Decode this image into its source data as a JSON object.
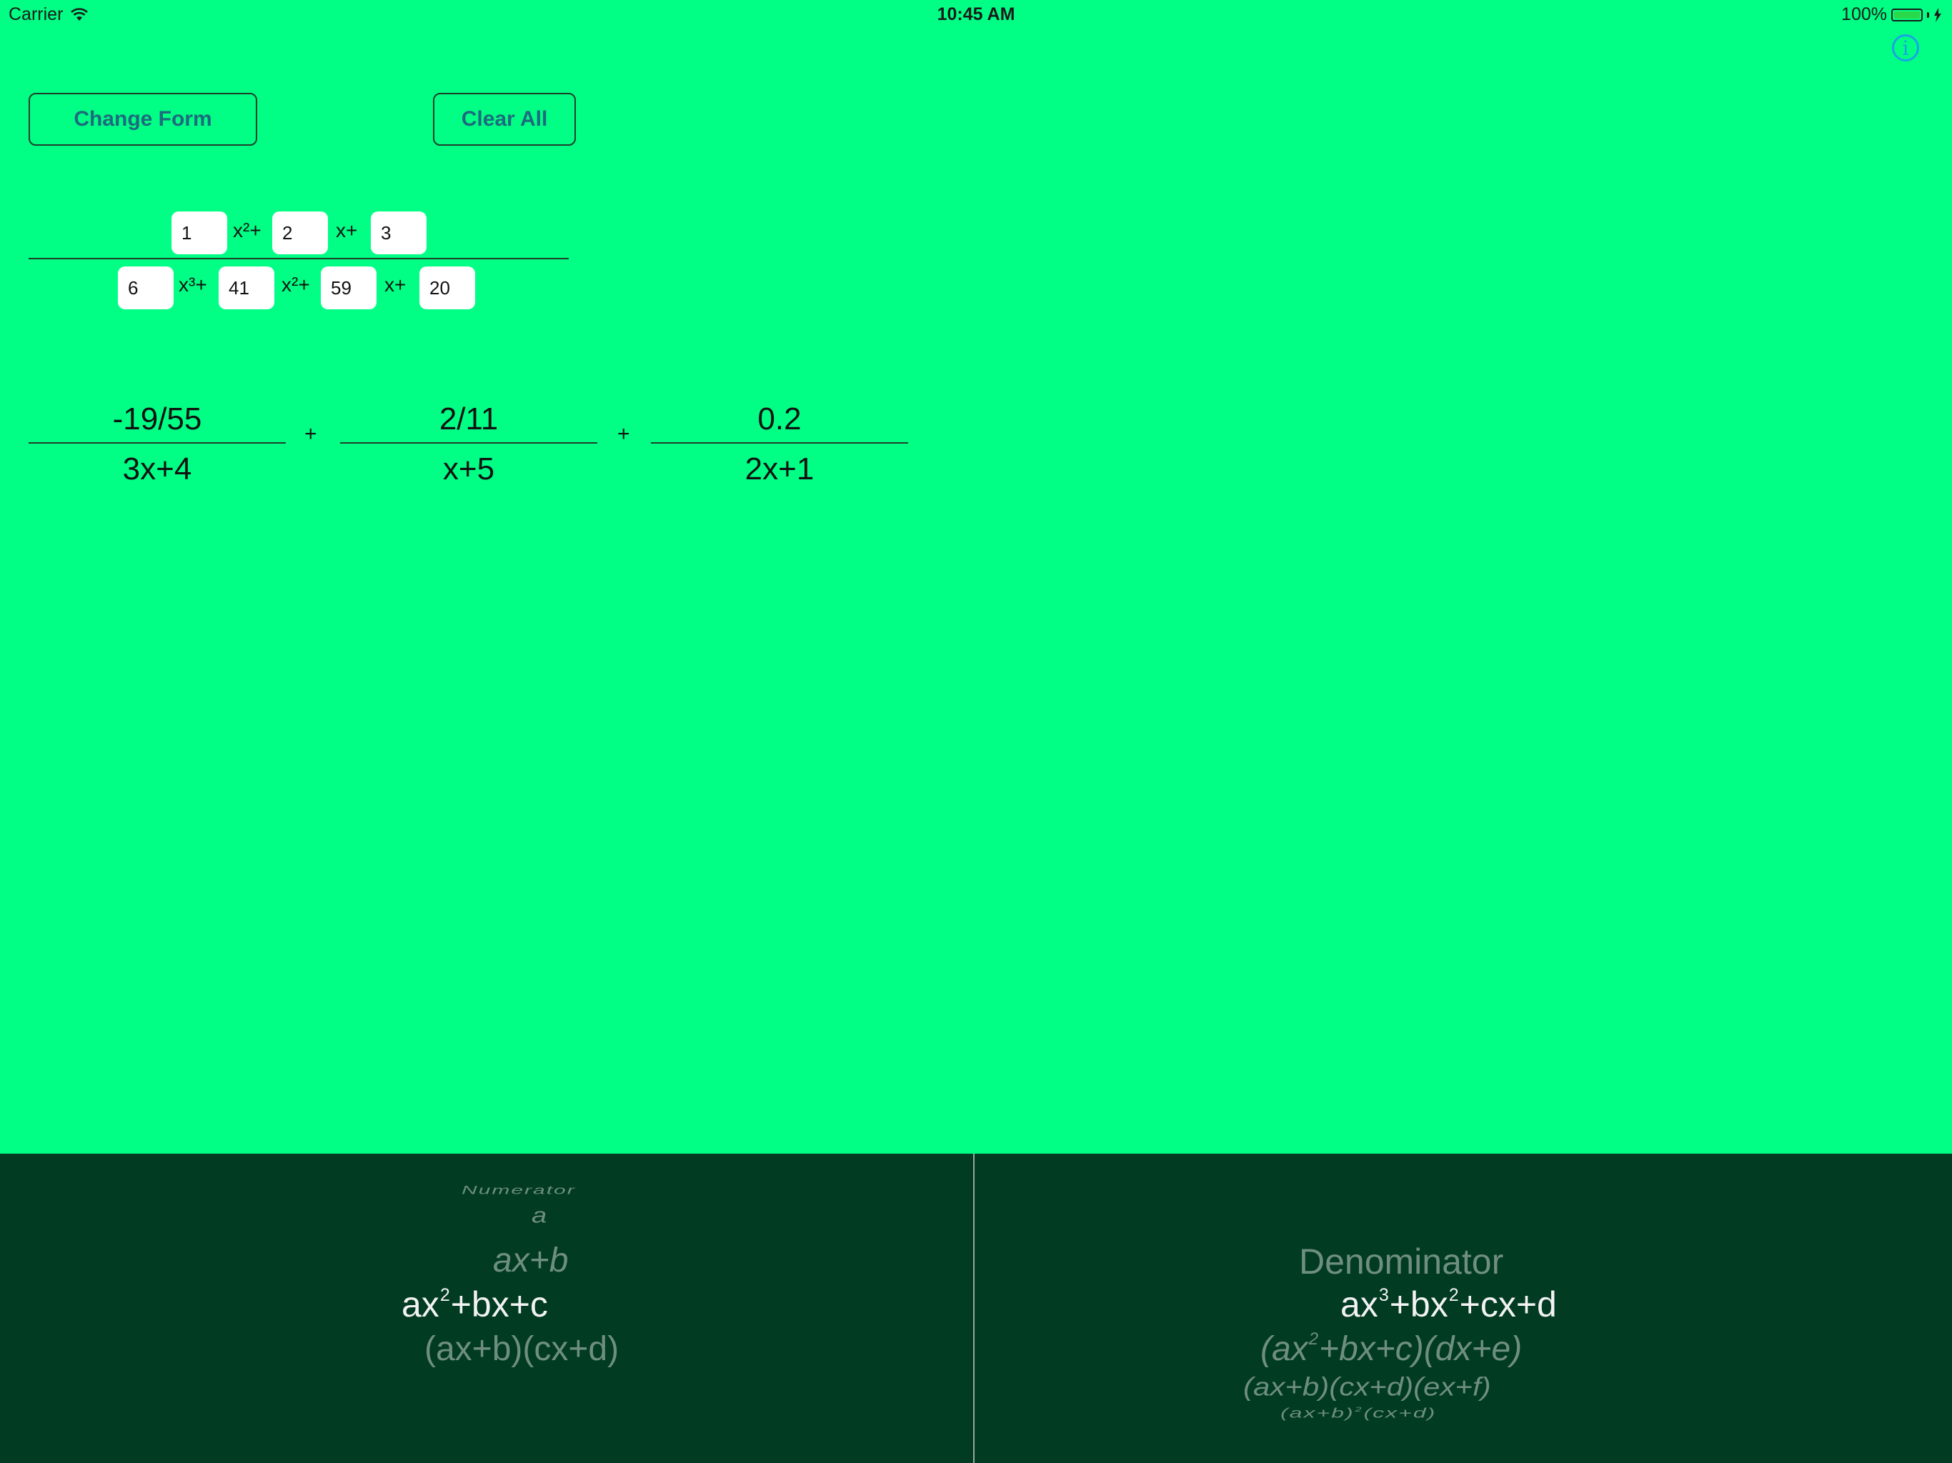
{
  "status_bar": {
    "carrier": "Carrier",
    "time": "10:45 AM",
    "battery": "100%",
    "battery_level": 1.0
  },
  "toolbar": {
    "change_form_label": "Change Form",
    "clear_all_label": "Clear All",
    "info_label": "i"
  },
  "numerator": {
    "coefficients": [
      "1",
      "2",
      "3"
    ],
    "terms": [
      "x²+",
      "x+"
    ]
  },
  "denominator": {
    "coefficients": [
      "6",
      "41",
      "59",
      "20"
    ],
    "terms": [
      "x³+",
      "x²+",
      "x+"
    ]
  },
  "result": {
    "fractions": [
      {
        "numerator": "-19/55",
        "denominator": "3x+4"
      },
      {
        "numerator": "2/11",
        "denominator": "x+5"
      },
      {
        "numerator": "0.2",
        "denominator": "2x+1"
      }
    ],
    "operator": "+"
  },
  "picker": {
    "numerator_column": {
      "header": "Numerator",
      "options": [
        "a",
        "ax+b",
        "ax²+bx+c",
        "(ax+b)(cx+d)"
      ],
      "selected": "ax²+bx+c"
    },
    "denominator_column": {
      "header": "Denominator",
      "options": [
        "ax³+bx²+cx+d",
        "(ax²+bx+c)(dx+e)",
        "(ax+b)(cx+d)(ex+f)",
        "(ax+b)²(cx+d)"
      ],
      "selected": "ax³+bx²+cx+d"
    }
  },
  "colors": {
    "background": "#00ff84",
    "picker_background": "#003b22",
    "button_text": "#1e6a7e",
    "info_accent": "#1aa3e6"
  }
}
